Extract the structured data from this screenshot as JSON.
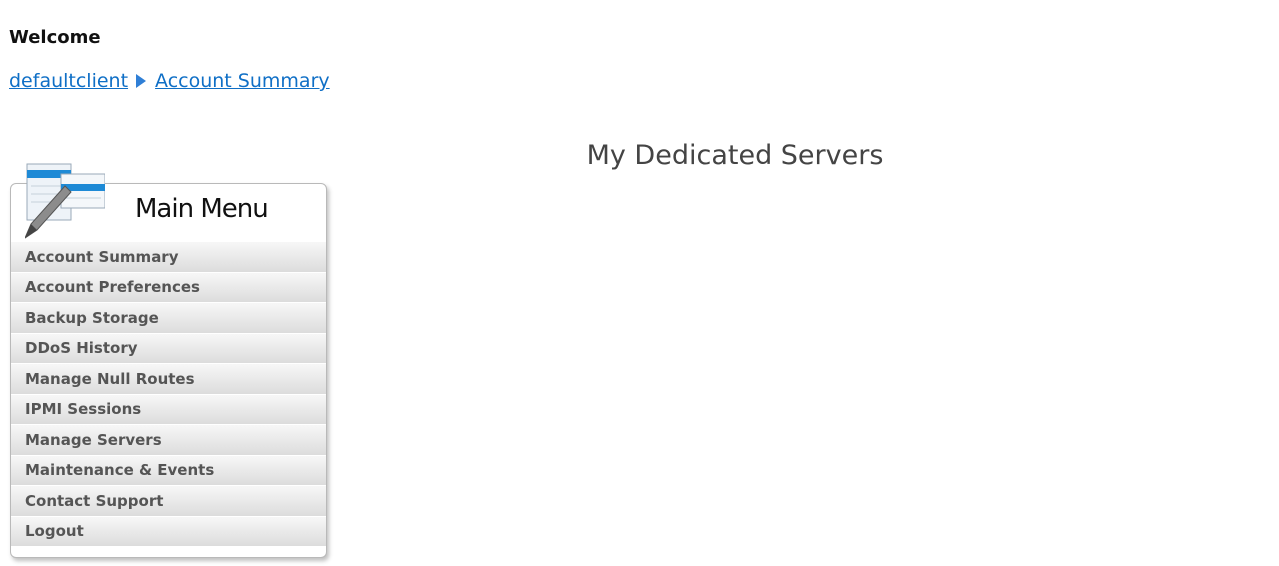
{
  "header": {
    "welcome": "Welcome"
  },
  "breadcrumb": {
    "items": [
      {
        "label": "defaultclient"
      },
      {
        "label": "Account Summary"
      }
    ]
  },
  "main": {
    "title": "My Dedicated Servers"
  },
  "menu": {
    "title": "Main Menu",
    "items": [
      {
        "label": "Account Summary"
      },
      {
        "label": "Account Preferences"
      },
      {
        "label": "Backup Storage"
      },
      {
        "label": "DDoS History"
      },
      {
        "label": "Manage Null Routes"
      },
      {
        "label": "IPMI Sessions"
      },
      {
        "label": "Manage Servers"
      },
      {
        "label": "Maintenance & Events"
      },
      {
        "label": "Contact Support"
      },
      {
        "label": "Logout"
      }
    ]
  }
}
